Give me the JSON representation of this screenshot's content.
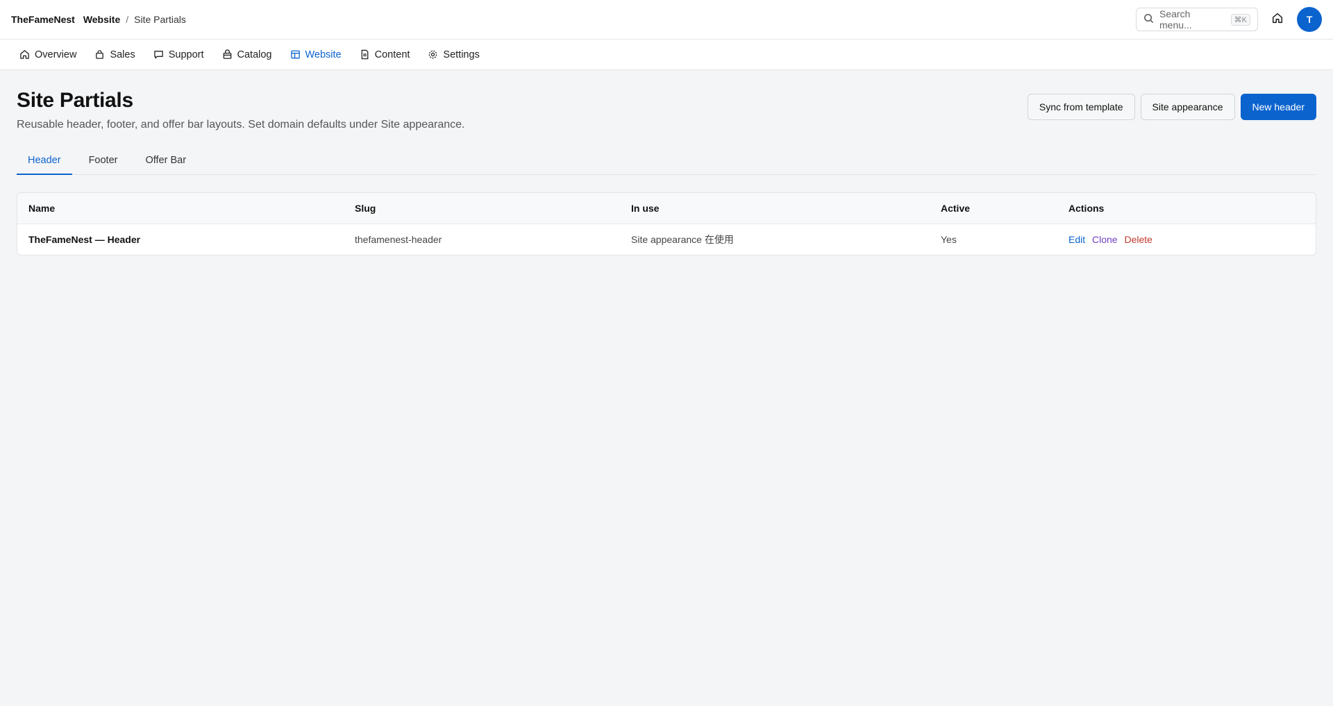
{
  "header": {
    "brand": "TheFameNest",
    "section": "Website",
    "separator": "/",
    "page": "Site Partials",
    "search_placeholder": "Search menu...",
    "search_shortcut": "⌘K",
    "avatar_initial": "T"
  },
  "nav": {
    "items": [
      {
        "label": "Overview",
        "icon": "home-icon"
      },
      {
        "label": "Sales",
        "icon": "bag-icon"
      },
      {
        "label": "Support",
        "icon": "chat-icon"
      },
      {
        "label": "Catalog",
        "icon": "box-icon"
      },
      {
        "label": "Website",
        "icon": "layout-icon",
        "active": true
      },
      {
        "label": "Content",
        "icon": "document-icon"
      },
      {
        "label": "Settings",
        "icon": "gear-icon"
      }
    ]
  },
  "main": {
    "title": "Site Partials",
    "subtitle": "Reusable header, footer, and offer bar layouts. Set domain defaults under Site appearance.",
    "buttons": {
      "sync": "Sync from template",
      "appearance": "Site appearance",
      "new": "New header"
    },
    "tabs": [
      "Header",
      "Footer",
      "Offer Bar"
    ],
    "table": {
      "columns": [
        "Name",
        "Slug",
        "In use",
        "Active",
        "Actions"
      ],
      "rows": [
        {
          "name": "TheFameNest — Header",
          "slug": "thefamenest-header",
          "in_use": "Site appearance 在使用",
          "active": "Yes",
          "actions": {
            "edit": "Edit",
            "clone": "Clone",
            "delete": "Delete"
          }
        }
      ]
    }
  },
  "colors": {
    "accent": "#0b63ce",
    "clone": "#6f42c1",
    "delete": "#c0392b"
  }
}
